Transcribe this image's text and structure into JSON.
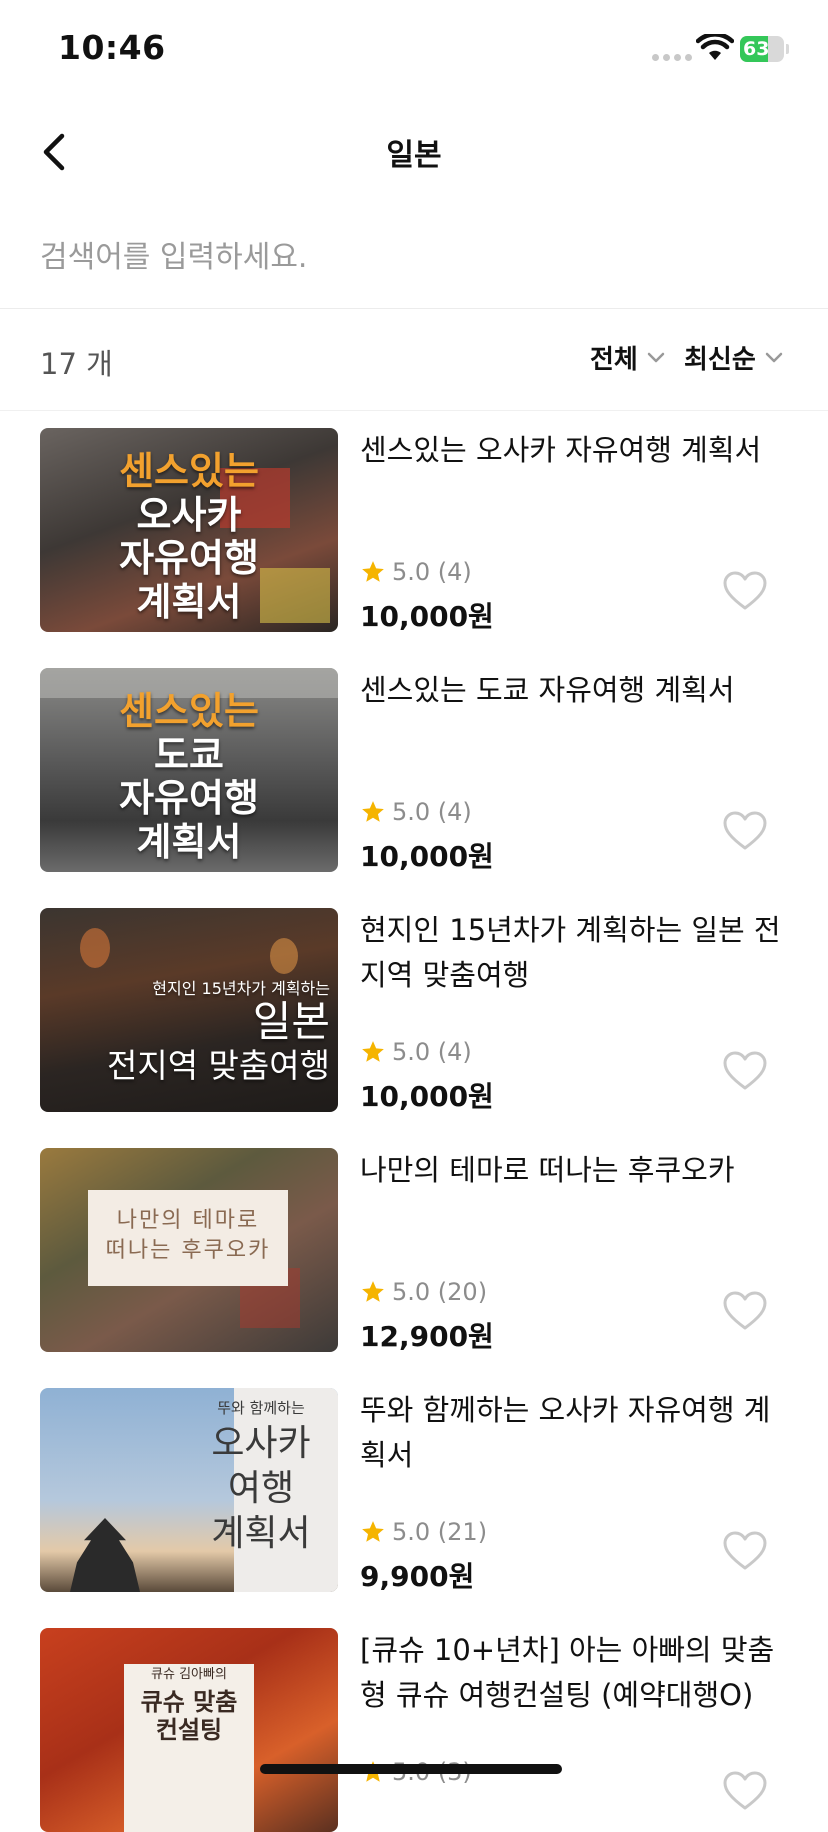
{
  "status": {
    "time": "10:46",
    "battery": "63",
    "battery_level": 0.63
  },
  "nav": {
    "title": "일본"
  },
  "search": {
    "placeholder": "검색어를 입력하세요.",
    "value": ""
  },
  "filter": {
    "count": "17 개",
    "category": "전체",
    "sort": "최신순"
  },
  "colors": {
    "star": "#f5b400",
    "heart_outline": "#c9c9c9",
    "battery": "#34c759"
  },
  "items": [
    {
      "title": "센스있는 오사카 자유여행 계획서",
      "rating": "5.0 (4)",
      "price": "10,000원",
      "thumb": {
        "line1": "센스있는",
        "line2": "오사카",
        "line3": "자유여행",
        "line4": "계획서"
      }
    },
    {
      "title": "센스있는 도쿄 자유여행 계획서",
      "rating": "5.0 (4)",
      "price": "10,000원",
      "thumb": {
        "line1": "센스있는",
        "line2": "도쿄",
        "line3": "자유여행",
        "line4": "계획서"
      }
    },
    {
      "title": "현지인 15년차가 계획하는 일본 전지역 맞춤여행",
      "rating": "5.0 (4)",
      "price": "10,000원",
      "thumb": {
        "line1": "현지인 15년차가 계획하는",
        "line2": "일본",
        "line3": "전지역 맞춤여행"
      }
    },
    {
      "title": "나만의 테마로 떠나는 후쿠오카",
      "rating": "5.0 (20)",
      "price": "12,900원",
      "thumb": {
        "line1": "나만의 테마로",
        "line2": "떠나는 후쿠오카"
      }
    },
    {
      "title": "뚜와 함께하는 오사카 자유여행 계획서",
      "rating": "5.0 (21)",
      "price": "9,900원",
      "thumb": {
        "line1": "뚜와 함께하는",
        "line2": "오사카",
        "line3": "여행",
        "line4": "계획서"
      }
    },
    {
      "title": "[큐슈 10+년차] 아는 아빠의 맞춤형 큐슈 여행컨설팅 (예약대행O)",
      "rating": "5.0 (3)",
      "price": "",
      "thumb": {
        "line1": "큐슈 김아빠의",
        "line2": "큐슈 맞춤",
        "line3": "컨설팅"
      }
    }
  ]
}
